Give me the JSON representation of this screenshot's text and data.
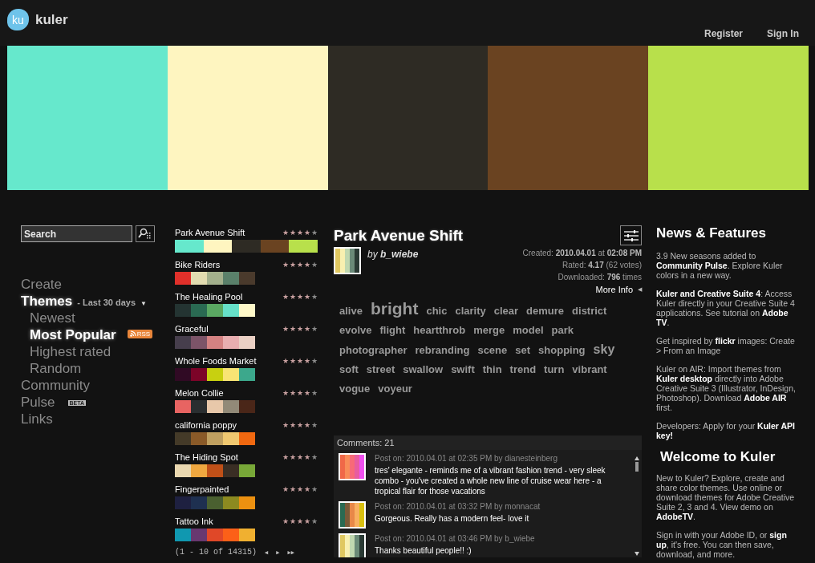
{
  "header": {
    "logo_badge": "ku",
    "logo_text": "kuler",
    "links": [
      "Register",
      "Sign In"
    ]
  },
  "hero": {
    "swatches": [
      {
        "color": "#66e8cc"
      },
      {
        "color": "#fef5c0"
      },
      {
        "color": "#2e2b24"
      },
      {
        "color": "#6a4321"
      },
      {
        "color": "#b8e04b"
      }
    ]
  },
  "search": {
    "placeholder": "Search"
  },
  "nav": [
    {
      "label": "Create",
      "selected": false
    },
    {
      "label": "Themes",
      "selected": true,
      "filter": "- Last 30 days",
      "caret": "▼",
      "children": [
        {
          "label": "Newest",
          "selected": false
        },
        {
          "label": "Most Popular",
          "selected": true,
          "badge": "RSS"
        },
        {
          "label": "Highest rated",
          "selected": false
        },
        {
          "label": "Random",
          "selected": false
        }
      ]
    },
    {
      "label": "Community",
      "selected": false
    },
    {
      "label": "Pulse",
      "selected": false,
      "tag": "BETA"
    },
    {
      "label": "Links",
      "selected": false
    }
  ],
  "themes": [
    {
      "name": "Park Avenue Shift",
      "stars": 4,
      "selected": true,
      "swatches": [
        {
          "color": "#66e8cc"
        },
        {
          "color": "#fef5c0"
        },
        {
          "color": "#2e2b24"
        },
        {
          "color": "#6a4321"
        },
        {
          "color": "#b8e04b"
        }
      ]
    },
    {
      "name": "Bike Riders",
      "stars": 4,
      "selected": false,
      "swatches": [
        {
          "color": "#e0302a"
        },
        {
          "color": "#e2dcb0"
        },
        {
          "color": "#a3b08c"
        },
        {
          "color": "#5a806a"
        },
        {
          "color": "#4a3a2c"
        }
      ]
    },
    {
      "name": "The Healing Pool",
      "stars": 4,
      "selected": false,
      "swatches": [
        {
          "color": "#243432"
        },
        {
          "color": "#2a6a52"
        },
        {
          "color": "#5aa862"
        },
        {
          "color": "#66e0c8"
        },
        {
          "color": "#fef8c8"
        }
      ]
    },
    {
      "name": "Graceful",
      "stars": 4,
      "selected": false,
      "swatches": [
        {
          "color": "#463e4c"
        },
        {
          "color": "#7c5468"
        },
        {
          "color": "#d48282"
        },
        {
          "color": "#e8aeb0"
        },
        {
          "color": "#ead0c4"
        }
      ]
    },
    {
      "name": "Whole Foods Market",
      "stars": 4,
      "selected": false,
      "swatches": [
        {
          "color": "#300a24"
        },
        {
          "color": "#7c0428"
        },
        {
          "color": "#c8d010"
        },
        {
          "color": "#f8e474"
        },
        {
          "color": "#3ca88c"
        }
      ]
    },
    {
      "name": "Melon Collie",
      "stars": 4,
      "selected": false,
      "swatches": [
        {
          "color": "#e86462"
        },
        {
          "color": "#2a2e30"
        },
        {
          "color": "#e8c8aa"
        },
        {
          "color": "#928a78"
        },
        {
          "color": "#4a2618"
        }
      ]
    },
    {
      "name": "california poppy",
      "stars": 4,
      "selected": false,
      "swatches": [
        {
          "color": "#443a28"
        },
        {
          "color": "#8a5a28"
        },
        {
          "color": "#c0a060"
        },
        {
          "color": "#f0c870"
        },
        {
          "color": "#f06810"
        }
      ]
    },
    {
      "name": "The Hiding Spot",
      "stars": 4,
      "selected": false,
      "swatches": [
        {
          "color": "#ead8b0"
        },
        {
          "color": "#f0a840"
        },
        {
          "color": "#c05018"
        },
        {
          "color": "#3a2e24"
        },
        {
          "color": "#78a838"
        }
      ]
    },
    {
      "name": "Fingerpainted",
      "stars": 4,
      "selected": false,
      "swatches": [
        {
          "color": "#1e2040"
        },
        {
          "color": "#1e3050"
        },
        {
          "color": "#4a6030"
        },
        {
          "color": "#8c8a20"
        },
        {
          "color": "#ec9010"
        }
      ]
    },
    {
      "name": "Tattoo Ink",
      "stars": 4,
      "selected": false,
      "swatches": [
        {
          "color": "#1098b0"
        },
        {
          "color": "#683870"
        },
        {
          "color": "#e04828"
        },
        {
          "color": "#fc6018"
        },
        {
          "color": "#f0b030"
        }
      ]
    }
  ],
  "pagination": {
    "range": "(1 - 10 of 14315)",
    "controls": [
      "◀",
      "▶",
      "▶▶"
    ]
  },
  "detail": {
    "title": "Park Avenue Shift",
    "author": "by **b_wiebe**",
    "thumb": [
      {
        "color": "#e0c860"
      },
      {
        "color": "#f8f0b0"
      },
      {
        "color": "#c0d8b0"
      },
      {
        "color": "#6a8a78"
      },
      {
        "color": "#2a3a34"
      }
    ],
    "meta": [
      "Created: **2010.04.01** at **02:08 PM**",
      "Rated: **4.17** (62 votes)",
      "Downloaded: **796** times"
    ],
    "more_info": "More Info",
    "more_caret": "◀",
    "tags": [
      {
        "text": "alive",
        "kind": "normal"
      },
      {
        "text": "bright",
        "kind": "large"
      },
      {
        "text": "chic",
        "kind": "normal"
      },
      {
        "text": "clarity",
        "kind": "normal"
      },
      {
        "text": "clear",
        "kind": "normal"
      },
      {
        "text": "demure",
        "kind": "normal"
      },
      {
        "text": "district",
        "kind": "normal"
      },
      {
        "text": "evolve",
        "kind": "normal"
      },
      {
        "text": "flight",
        "kind": "normal"
      },
      {
        "text": "heartthrob",
        "kind": "normal"
      },
      {
        "text": "merge",
        "kind": "normal"
      },
      {
        "text": "model",
        "kind": "normal"
      },
      {
        "text": "park",
        "kind": "normal"
      },
      {
        "text": "photographer",
        "kind": "normal"
      },
      {
        "text": "rebranding",
        "kind": "normal"
      },
      {
        "text": "scene",
        "kind": "normal"
      },
      {
        "text": "set",
        "kind": "normal"
      },
      {
        "text": "shopping",
        "kind": "normal"
      },
      {
        "text": "sky",
        "kind": "medium"
      },
      {
        "text": "soft",
        "kind": "normal"
      },
      {
        "text": "street",
        "kind": "normal"
      },
      {
        "text": "swallow",
        "kind": "normal"
      },
      {
        "text": "swift",
        "kind": "normal"
      },
      {
        "text": "thin",
        "kind": "normal"
      },
      {
        "text": "trend",
        "kind": "normal"
      },
      {
        "text": "turn",
        "kind": "normal"
      },
      {
        "text": "vibrant",
        "kind": "normal"
      },
      {
        "text": "vogue",
        "kind": "normal"
      },
      {
        "text": "voyeur",
        "kind": "normal"
      }
    ],
    "comments_header": "Comments: 21",
    "comments": [
      {
        "meta": "Post on: 2010.04.01 at 02:35 PM by dianesteinberg",
        "text": "tres' elegante - reminds me of a vibrant fashion trend - very sleek combo - you've created a whole new line of cruise wear here - a tropical flair for those vacations",
        "thumb": [
          {
            "color": "#f06848"
          },
          {
            "color": "#f88c58"
          },
          {
            "color": "#f86a78"
          },
          {
            "color": "#e85ca0"
          },
          {
            "color": "#f050f0"
          }
        ]
      },
      {
        "meta": "Post on: 2010.04.01 at 03:32 PM by monnacat",
        "text": "Gorgeous. Really has a modern feel- love it",
        "thumb": [
          {
            "color": "#2a6a52"
          },
          {
            "color": "#7a5a38"
          },
          {
            "color": "#e88848"
          },
          {
            "color": "#f8b060"
          },
          {
            "color": "#d8c010"
          }
        ]
      },
      {
        "meta": "Post on: 2010.04.01 at 03:46 PM by b_wiebe",
        "text": "Thanks beautiful people!! :)",
        "thumb": [
          {
            "color": "#e0c860"
          },
          {
            "color": "#f8f0b0"
          },
          {
            "color": "#c0d8b0"
          },
          {
            "color": "#6a8a78"
          },
          {
            "color": "#2a3a34"
          }
        ]
      }
    ]
  },
  "news": {
    "title": "News & Features",
    "items": [
      "3.9 New seasons added to **Community Pulse**. Explore Kuler colors in a new way.",
      "**Kuler and Creative Suite 4**: Access Kuler directly in your Creative Suite 4 applications. See tutorial on **Adobe TV**.",
      "Get inspired by **flickr** images: Create > From an Image",
      "Kuler on AIR: Import themes from **Kuler desktop** directly into Adobe Creative Suite 3 (Illustrator, InDesign, Photoshop). Download **Adobe AIR** first.",
      "Developers: Apply for your **Kuler API key!**"
    ]
  },
  "welcome": {
    "title": "Welcome to Kuler",
    "items": [
      "New to Kuler? Explore, create and share color themes. Use online or download themes for Adobe Creative Suite 2, 3 and 4. View demo on **AdobeTV**.",
      "Sign in with your Adobe ID, or **sign up**, it's free. You can then save, download, and more."
    ]
  }
}
